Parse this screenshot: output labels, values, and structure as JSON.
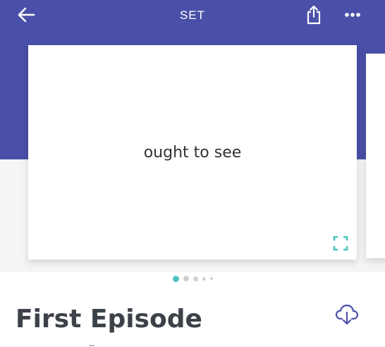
{
  "header": {
    "title": "SET",
    "back_icon": "arrow-left-icon",
    "share_icon": "share-icon",
    "more_icon": "more-horizontal-icon"
  },
  "card": {
    "term": "ought to see",
    "expand_icon": "expand-icon"
  },
  "pager": {
    "count": 5,
    "active_index": 0
  },
  "set": {
    "title": "First Episode",
    "download_icon": "cloud-download-icon"
  },
  "colors": {
    "header_bg": "#4a50a8",
    "accent": "#4cc3c2",
    "download_icon": "#4a50a8",
    "title_text": "#3d4149"
  }
}
